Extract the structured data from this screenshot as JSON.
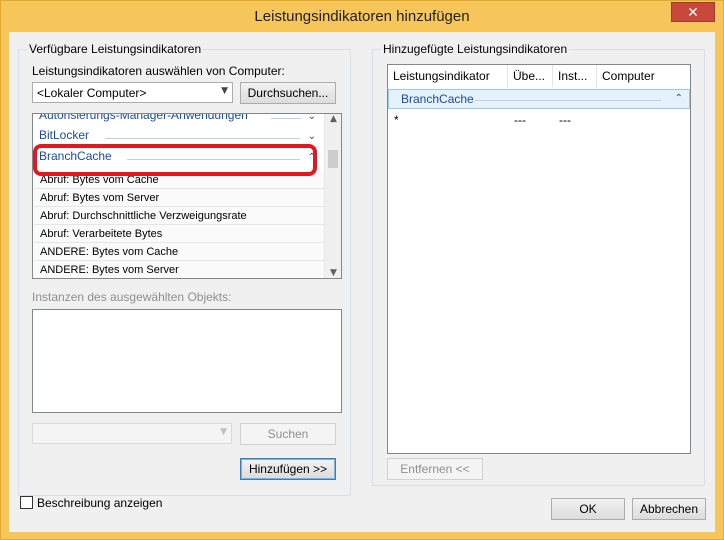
{
  "window": {
    "title": "Leistungsindikatoren hinzufügen",
    "close_glyph": "✕"
  },
  "left_group": {
    "title": "Verfügbare Leistungsindikatoren",
    "computer_label": "Leistungsindikatoren auswählen von Computer:",
    "computer_value": "<Lokaler Computer>",
    "browse_button": "Durchsuchen...",
    "objects": [
      {
        "label": "Autorisierungs-Manager-Anwendungen",
        "chevron": "⌄"
      },
      {
        "label": "BitLocker",
        "chevron": "⌄"
      },
      {
        "label": "BranchCache",
        "chevron": "⌃"
      }
    ],
    "counters": [
      "Abruf: Bytes vom Cache",
      "Abruf: Bytes vom Server",
      "Abruf: Durchschnittliche Verzweigungsrate",
      "Abruf: Verarbeitete Bytes",
      "ANDERE: Bytes vom Cache",
      "ANDERE: Bytes vom Server"
    ],
    "instances_label": "Instanzen des ausgewählten Objekts:",
    "search_value": "",
    "search_button": "Suchen",
    "add_button": "Hinzufügen >>"
  },
  "right_group": {
    "title": "Hinzugefügte Leistungsindikatoren",
    "columns": [
      "Leistungsindikator",
      "Übe...",
      "Inst...",
      "Computer"
    ],
    "group_row": {
      "label": "BranchCache",
      "chevron": "⌃"
    },
    "rows": [
      {
        "counter": "*",
        "parent": "---",
        "instance": "---",
        "computer": ""
      }
    ],
    "remove_button": "Entfernen <<"
  },
  "footer": {
    "show_description_label": "Beschreibung anzeigen",
    "ok_button": "OK",
    "cancel_button": "Abbrechen"
  },
  "colors": {
    "highlight": "#e3181e",
    "group_text": "#1b4b9b",
    "title_bar": "#f6c65a"
  }
}
